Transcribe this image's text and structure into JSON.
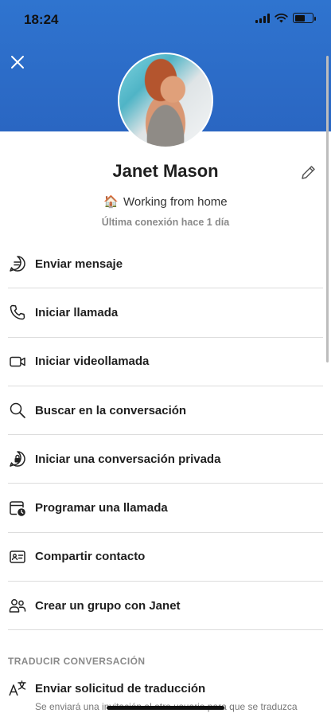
{
  "status_bar": {
    "time": "18:24",
    "battery_level": 0.6
  },
  "header": {
    "close_icon": "close-icon",
    "avatar_alt": "Janet Mason",
    "edit_icon": "pencil-icon"
  },
  "profile": {
    "name": "Janet Mason",
    "mood_emoji": "🏠",
    "mood_text": "Working from home",
    "last_seen": "Última conexión hace 1 día"
  },
  "actions": [
    {
      "label": "Enviar mensaje",
      "icon": "chat-bubble-icon"
    },
    {
      "label": "Iniciar llamada",
      "icon": "phone-icon"
    },
    {
      "label": "Iniciar videollamada",
      "icon": "video-camera-icon"
    },
    {
      "label": "Buscar en la conversación",
      "icon": "search-icon"
    },
    {
      "label": "Iniciar una conversación privada",
      "icon": "lock-chat-icon"
    },
    {
      "label": "Programar una llamada",
      "icon": "calendar-clock-icon"
    },
    {
      "label": "Compartir contacto",
      "icon": "contact-card-icon"
    },
    {
      "label": "Crear un grupo con Janet",
      "icon": "group-icon"
    }
  ],
  "translate_section": {
    "title": "TRADUCIR CONVERSACIÓN",
    "action_label": "Enviar solicitud de traducción",
    "description": "Se enviará una invitación al otro usuario para que se traduzca",
    "icon": "translate-icon"
  },
  "colors": {
    "header_blue": "#2f74cf",
    "divider": "#dcdcdc"
  }
}
